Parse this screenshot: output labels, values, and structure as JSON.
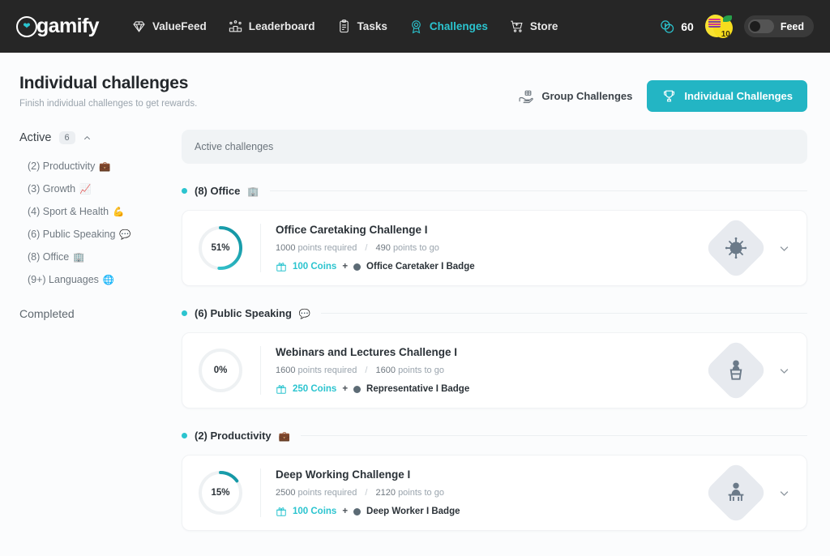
{
  "navbar": {
    "logo_text": "gamify",
    "items": [
      {
        "label": "ValueFeed",
        "icon": "diamond-icon",
        "active": false
      },
      {
        "label": "Leaderboard",
        "icon": "podium-people-icon",
        "active": false
      },
      {
        "label": "Tasks",
        "icon": "clipboard-icon",
        "active": false
      },
      {
        "label": "Challenges",
        "icon": "medal-icon",
        "active": true
      },
      {
        "label": "Store",
        "icon": "shopping-cart-icon",
        "active": false
      }
    ],
    "coins": "60",
    "avatar_level": "10",
    "feed_label": "Feed",
    "feed_on": false
  },
  "header": {
    "title": "Individual challenges",
    "subtitle": "Finish individual challenges to get rewards.",
    "group_challenges_label": "Group Challenges",
    "individual_challenges_label": "Individual Challenges"
  },
  "sidebar": {
    "active_label": "Active",
    "active_count": "6",
    "items": [
      {
        "label": "(2) Productivity",
        "emoji": "💼"
      },
      {
        "label": "(3) Growth",
        "emoji": "📈"
      },
      {
        "label": "(4) Sport & Health",
        "emoji": "💪"
      },
      {
        "label": "(6) Public Speaking",
        "emoji": "💬"
      },
      {
        "label": "(8) Office",
        "emoji": "🏢"
      },
      {
        "label": "(9+) Languages",
        "emoji": "🌐"
      }
    ],
    "completed_label": "Completed"
  },
  "main": {
    "active_bar_label": "Active challenges",
    "groups": [
      {
        "title": "(8) Office",
        "emoji": "🏢",
        "card": {
          "percent_label": "51%",
          "percent_value": 51,
          "title": "Office Caretaking Challenge I",
          "points_required": "1000",
          "points_required_label": "points required",
          "points_to_go": "490",
          "points_to_go_label": "points to go",
          "coins": "100 Coins",
          "plus": "+",
          "badge_label": "Office Caretaker I Badge",
          "badge_icon": "virus-spiky-circle-icon"
        }
      },
      {
        "title": "(6) Public Speaking",
        "emoji": "💬",
        "card": {
          "percent_label": "0%",
          "percent_value": 0,
          "title": "Webinars and Lectures Challenge I",
          "points_required": "1600",
          "points_required_label": "points required",
          "points_to_go": "1600",
          "points_to_go_label": "points to go",
          "coins": "250 Coins",
          "plus": "+",
          "badge_label": "Representative I Badge",
          "badge_icon": "speaker-podium-icon"
        }
      },
      {
        "title": "(2) Productivity",
        "emoji": "💼",
        "card": {
          "percent_label": "15%",
          "percent_value": 15,
          "title": "Deep Working Challenge I",
          "points_required": "2500",
          "points_required_label": "points required",
          "points_to_go": "2120",
          "points_to_go_label": "points to go",
          "coins": "100 Coins",
          "plus": "+",
          "badge_label": "Deep Worker I Badge",
          "badge_icon": "person-at-desk-icon"
        }
      }
    ]
  },
  "colors": {
    "accent": "#2bc4cf",
    "accent_dark": "#23b5c4",
    "navbar_bg": "#262626",
    "page_bg": "#fbfcfd"
  }
}
